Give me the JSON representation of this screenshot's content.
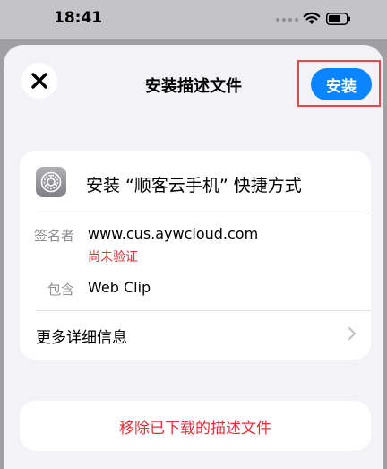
{
  "status_bar": {
    "time": "18:41"
  },
  "header": {
    "title": "安装描述文件",
    "install_label": "安装",
    "accent_color": "#0a84ff",
    "highlight_color": "#e54848"
  },
  "profile": {
    "title": "安装 “顺客云手机” 快捷方式",
    "icon": "gear-icon",
    "signer_label": "签名者",
    "signer_value": "www.cus.aywcloud.com",
    "verification_status": "尚未验证",
    "contains_label": "包含",
    "contains_value": "Web Clip",
    "more_info_label": "更多详细信息"
  },
  "actions": {
    "remove_label": "移除已下载的描述文件",
    "destructive_color": "#e0323a"
  }
}
